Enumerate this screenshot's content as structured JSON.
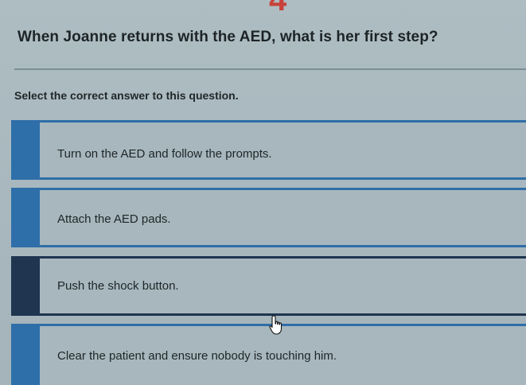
{
  "question": {
    "number": "4",
    "title": "When Joanne returns with the AED, what is her first step?",
    "instruction": "Select the correct answer to this question."
  },
  "options": [
    {
      "label": "Turn on the AED and follow the prompts.",
      "selected": false
    },
    {
      "label": "Attach the AED pads.",
      "selected": false
    },
    {
      "label": "Push the shock button.",
      "selected": true
    },
    {
      "label": "Clear the patient and ensure nobody is touching him.",
      "selected": false
    }
  ],
  "colors": {
    "background": "#a9b9bf",
    "accent": "#2e6fa9",
    "selected_accent": "#1f3550",
    "question_number": "#c8423a"
  },
  "cursor_icon": "hand-pointer-icon"
}
